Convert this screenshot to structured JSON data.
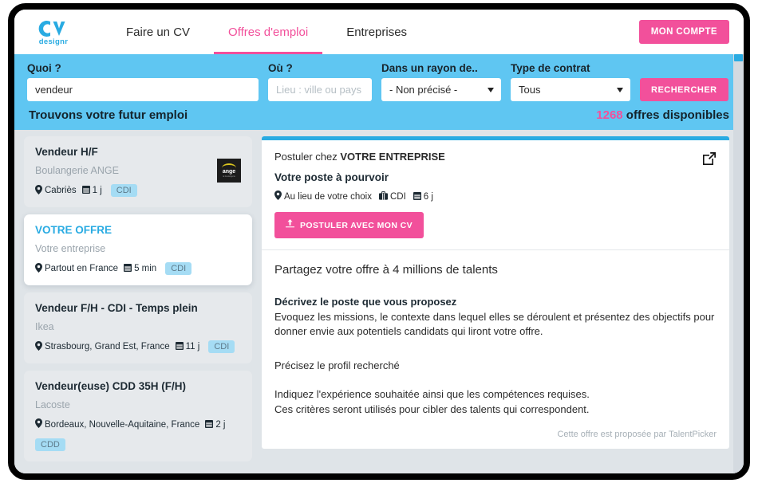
{
  "header": {
    "logo_text": "designr",
    "logo_icon": "cv-logo-icon",
    "nav": [
      {
        "label": "Faire un CV",
        "active": false
      },
      {
        "label": "Offres d'emploi",
        "active": true
      },
      {
        "label": "Entreprises",
        "active": false
      }
    ],
    "account_label": "MON COMPTE"
  },
  "search": {
    "what_label": "Quoi ?",
    "what_value": "vendeur",
    "where_label": "Où ?",
    "where_placeholder": "Lieu : ville ou pays",
    "where_value": "",
    "radius_label": "Dans un rayon de..",
    "radius_value": "- Non précisé -",
    "contract_label": "Type de contrat",
    "contract_value": "Tous",
    "search_button": "RECHERCHER",
    "tagline": "Trouvons votre futur emploi",
    "offers_count": "1268",
    "offers_suffix": " offres disponibles"
  },
  "jobs": [
    {
      "title": "Vendeur H/F",
      "company": "Boulangerie ANGE",
      "location": "Cabriès",
      "age": "1 j",
      "contract": "CDI",
      "selected": false,
      "has_logo": true,
      "logo_name": "ange",
      "logo_sub": "la boulangerie"
    },
    {
      "title": "VOTRE OFFRE",
      "company": "Votre entreprise",
      "location": "Partout en France",
      "age": "5 min",
      "contract": "CDI",
      "selected": true,
      "has_logo": false
    },
    {
      "title": "Vendeur F/H - CDI - Temps plein",
      "company": "Ikea",
      "location": "Strasbourg, Grand Est, France",
      "age": "11 j",
      "contract": "CDI",
      "selected": false,
      "has_logo": false
    },
    {
      "title": "Vendeur(euse) CDD 35H (F/H)",
      "company": "Lacoste",
      "location": "Bordeaux, Nouvelle-Aquitaine, France",
      "age": "2 j",
      "contract": "CDD",
      "selected": false,
      "has_logo": false,
      "badge_wraps": true
    }
  ],
  "detail": {
    "postuler_prefix": "Postuler chez ",
    "company_name": "VOTRE ENTREPRISE",
    "post_title": "Votre poste à pourvoir",
    "meta_location": "Au lieu de votre choix",
    "meta_contract": "CDI",
    "meta_age": "6 j",
    "apply_label": "POSTULER AVEC MON CV",
    "apply_icon": "upload-icon",
    "external_link_icon": "external-link-icon",
    "share_heading": "Partagez votre offre à 4 millions de talents",
    "section1_heading": "Décrivez le poste que vous proposez",
    "section1_text": "Evoquez les missions, le contexte dans lequel elles se déroulent et présentez des objectifs pour donner envie aux potentiels candidats qui liront votre offre.",
    "section2_heading": "Précisez le profil recherché",
    "section2_line1": "Indiquez l'expérience souhaitée ainsi que les compétences requises.",
    "section2_line2": "Ces critères seront utilisés pour cibler des talents qui correspondent.",
    "footer_note": "Cette offre est proposée par TalentPicker"
  },
  "colors": {
    "accent_blue": "#29abe2",
    "band_blue": "#5fc6f2",
    "pink": "#f2509b",
    "badge_blue": "#a5dcf4",
    "page_bg": "#dfe4e8"
  }
}
